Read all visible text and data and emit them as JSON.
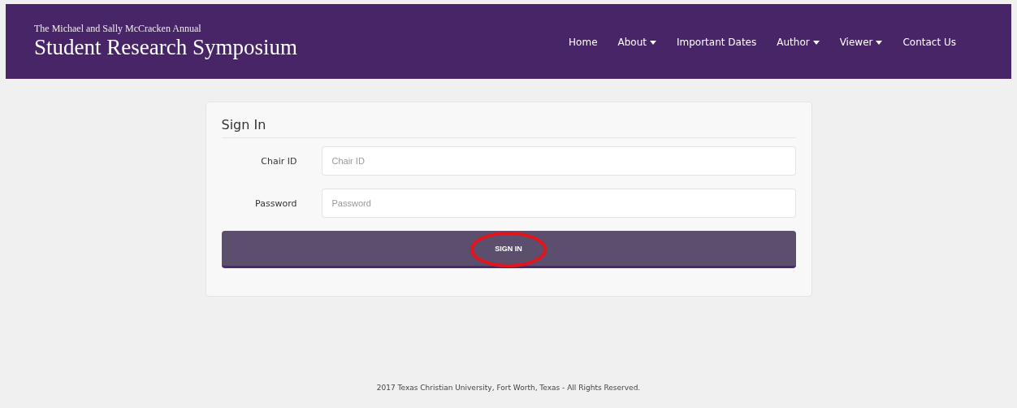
{
  "header": {
    "subtitle": "The Michael and Sally McCracken Annual",
    "title": "Student Research Symposium"
  },
  "nav": [
    {
      "label": "Home",
      "dropdown": false
    },
    {
      "label": "About",
      "dropdown": true
    },
    {
      "label": "Important Dates",
      "dropdown": false
    },
    {
      "label": "Author",
      "dropdown": true
    },
    {
      "label": "Viewer",
      "dropdown": true
    },
    {
      "label": "Contact Us",
      "dropdown": false
    }
  ],
  "form": {
    "title": "Sign In",
    "fields": [
      {
        "label": "Chair ID",
        "placeholder": "Chair ID"
      },
      {
        "label": "Password",
        "placeholder": "Password"
      }
    ],
    "button": {
      "label": "SIGN IN",
      "highlighted": true
    }
  },
  "footer": "2017 Texas Christian University, Fort Worth, Texas - All Rights Reserved."
}
